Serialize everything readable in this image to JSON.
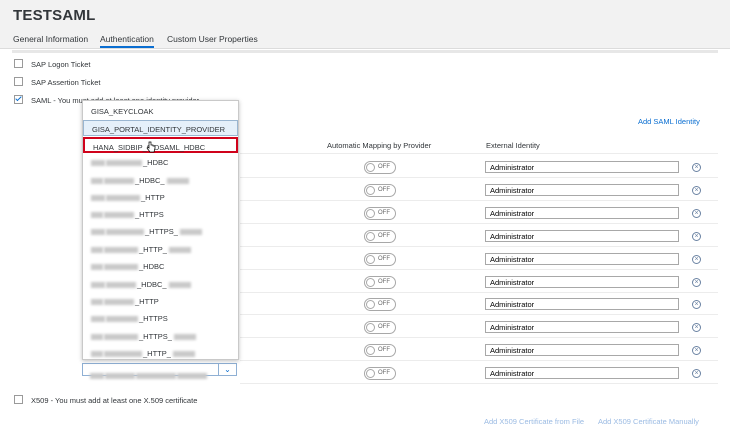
{
  "app": {
    "title": "TESTSAML"
  },
  "tabs": [
    {
      "label": "General Information"
    },
    {
      "label": "Authentication"
    },
    {
      "label": "Custom User Properties"
    }
  ],
  "auth": {
    "logon_ticket": "SAP Logon Ticket",
    "assertion_ticket": "SAP Assertion Ticket",
    "saml": "SAML - You must add at least one identity provider",
    "x509": "X509 - You must add at least one X.509 certificate"
  },
  "links": {
    "add_saml": "Add SAML Identity",
    "add_x509_file": "Add X509 Certificate from File",
    "add_x509_manual": "Add X509 Certificate Manually"
  },
  "table": {
    "headers": {
      "mapping": "Automatic Mapping by Provider",
      "external": "External Identity"
    },
    "toggle_label": "OFF",
    "rows": [
      {
        "external": "Administrator"
      },
      {
        "external": "Administrator"
      },
      {
        "external": "Administrator"
      },
      {
        "external": "Administrator"
      },
      {
        "external": "Administrator"
      },
      {
        "external": "Administrator"
      },
      {
        "external": "Administrator"
      },
      {
        "external": "Administrator"
      },
      {
        "external": "Administrator"
      },
      {
        "external": "Administrator"
      }
    ]
  },
  "dropdown": {
    "items": [
      {
        "label": "GISA_KEYCLOAK"
      },
      {
        "label": "GISA_PORTAL_IDENTITY_PROVIDER"
      },
      {
        "label": "HANA_SIDBIP_SIDSAML_HDBC"
      },
      {
        "label": "_HDBC"
      },
      {
        "label": "_HDBC_"
      },
      {
        "label": "_HTTP"
      },
      {
        "label": "_HTTPS"
      },
      {
        "label": "_HTTPS_"
      },
      {
        "label": "_HTTP_"
      },
      {
        "label": "_HDBC"
      },
      {
        "label": "_HDBC_"
      },
      {
        "label": "_HTTP"
      },
      {
        "label": "_HTTPS"
      },
      {
        "label": "_HTTPS_"
      },
      {
        "label": "_HTTP_"
      }
    ]
  },
  "icons": {
    "remove": "remove-circle-icon",
    "chevron": "chevron-down-icon",
    "cursor": "hand-cursor-icon"
  },
  "colors": {
    "accent": "#0a6ed1",
    "highlight_border": "#d0021b"
  }
}
